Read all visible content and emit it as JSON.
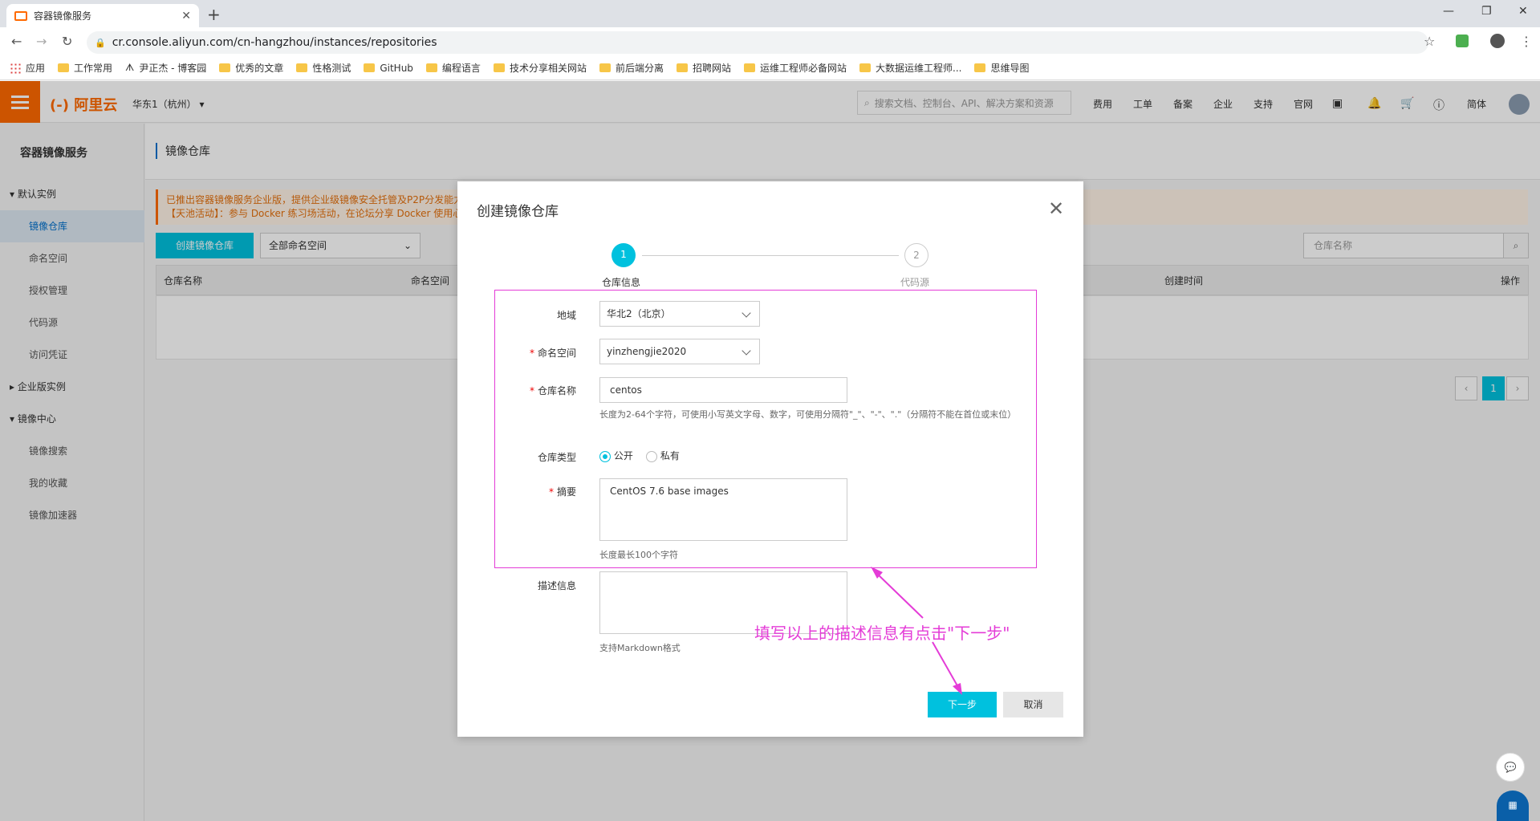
{
  "browser": {
    "tab_title": "容器镜像服务",
    "url": "cr.console.aliyun.com/cn-hangzhou/instances/repositories",
    "bookmarks": [
      "应用",
      "工作常用",
      "尹正杰 - 博客园",
      "优秀的文章",
      "性格测试",
      "GitHub",
      "编程语言",
      "技术分享相关网站",
      "前后端分离",
      "招聘网站",
      "运维工程师必备网站",
      "大数据运维工程师...",
      "思维导图"
    ]
  },
  "header": {
    "logo": "阿里云",
    "region": "华东1（杭州）",
    "search_placeholder": "搜索文档、控制台、API、解决方案和资源",
    "nav": [
      "费用",
      "工单",
      "备案",
      "企业",
      "支持",
      "官网"
    ],
    "lang": "简体"
  },
  "sidebar": {
    "title": "容器镜像服务",
    "items": [
      {
        "label": "默认实例",
        "type": "group",
        "open": true
      },
      {
        "label": "镜像仓库",
        "type": "sub",
        "active": true
      },
      {
        "label": "命名空间",
        "type": "sub"
      },
      {
        "label": "授权管理",
        "type": "sub"
      },
      {
        "label": "代码源",
        "type": "sub"
      },
      {
        "label": "访问凭证",
        "type": "sub"
      },
      {
        "label": "企业版实例",
        "type": "group",
        "open": false
      },
      {
        "label": "镜像中心",
        "type": "group",
        "open": true
      },
      {
        "label": "镜像搜索",
        "type": "sub"
      },
      {
        "label": "我的收藏",
        "type": "sub"
      },
      {
        "label": "镜像加速器",
        "type": "sub"
      }
    ]
  },
  "main": {
    "breadcrumb": "镜像仓库",
    "notice_line1": "已推出容器镜像服务企业版，提供企业级镜像安全托管及P2P分发能力",
    "notice_line2": "【天池活动】：参与 Docker 练习场活动，在论坛分享 Docker 使用心",
    "create_button": "创建镜像仓库",
    "namespace_select": "全部命名空间",
    "repo_search_placeholder": "仓库名称",
    "columns": [
      "仓库名称",
      "命名空间",
      "创建时间",
      "操作"
    ],
    "page": "1"
  },
  "dialog": {
    "title": "创建镜像仓库",
    "step1": "1",
    "step1_label": "仓库信息",
    "step2": "2",
    "step2_label": "代码源",
    "region_label": "地域",
    "region_value": "华北2（北京）",
    "namespace_label": "命名空间",
    "namespace_value": "yinzhengjie2020",
    "repo_name_label": "仓库名称",
    "repo_name_value": "centos",
    "repo_name_hint": "长度为2-64个字符，可使用小写英文字母、数字，可使用分隔符\"_\"、\"-\"、\".\"（分隔符不能在首位或末位）",
    "repo_type_label": "仓库类型",
    "type_public": "公开",
    "type_private": "私有",
    "summary_label": "摘要",
    "summary_value": "CentOS 7.6 base  images",
    "summary_hint": "长度最长100个字符",
    "desc_label": "描述信息",
    "desc_hint": "支持Markdown格式",
    "next_button": "下一步",
    "cancel_button": "取消"
  },
  "annotation": "填写以上的描述信息有点击\"下一步\"",
  "colors": {
    "accent": "#00c1de",
    "brand": "#ff6a00",
    "annotation": "#e43cd7"
  }
}
